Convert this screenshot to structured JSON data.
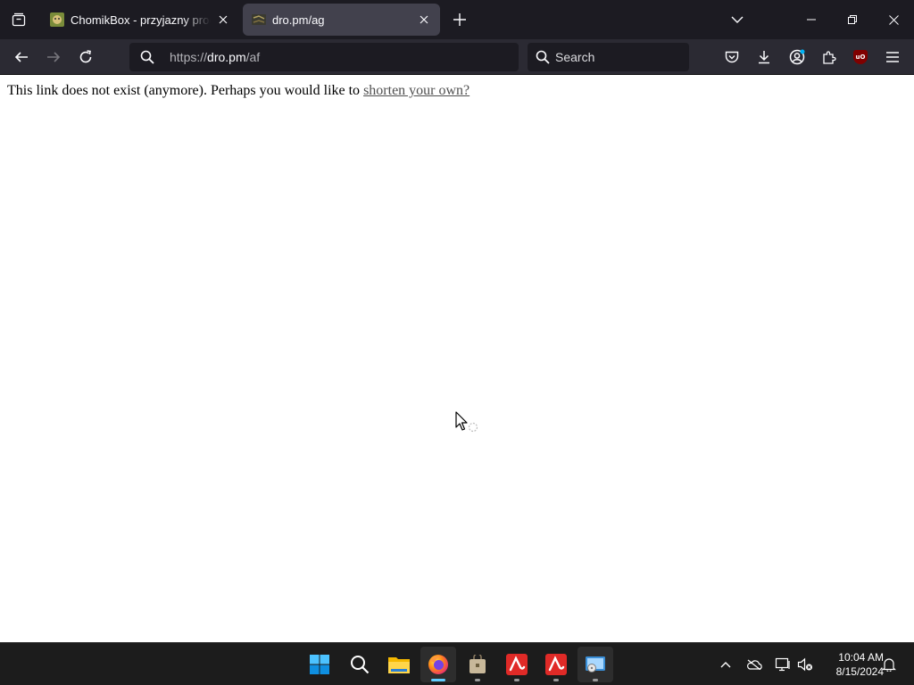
{
  "browser": {
    "tabs": [
      {
        "title": "ChomikBox - przyjazny program",
        "active": false,
        "favicon": "chomikbox-favicon"
      },
      {
        "title": "dro.pm/ag",
        "active": true,
        "favicon": "dro-pm-favicon"
      }
    ],
    "url": {
      "scheme": "https://",
      "host": "dro.pm",
      "path": "/af"
    },
    "search": {
      "placeholder": "Search"
    },
    "toolbar_icons": [
      "pocket-icon",
      "downloads-icon",
      "account-icon",
      "extensions-icon",
      "ublock-origin-icon",
      "menu-icon"
    ],
    "ublock_label": "uO"
  },
  "page": {
    "message": "This link does not exist (anymore). Perhaps you would like to ",
    "link_text": "shorten your own?"
  },
  "taskbar": {
    "apps": [
      "start-icon",
      "search-icon",
      "file-explorer-icon",
      "firefox-icon",
      "app-icon",
      "avira-icon",
      "avira-icon",
      "app-window-icon"
    ],
    "tray_icons": [
      "chevron-up-icon",
      "onedrive-icon",
      "network-icon",
      "volume-muted-icon",
      "notifications-icon"
    ],
    "time": "10:04 AM",
    "date": "8/15/2024"
  },
  "colors": {
    "tabbar_bg": "#1c1b22",
    "toolbar_bg": "#2b2a33",
    "active_tab_bg": "#42414d",
    "taskbar_bg": "#1c1c1c",
    "accent": "#60cdff",
    "ublock_red": "#800000"
  }
}
